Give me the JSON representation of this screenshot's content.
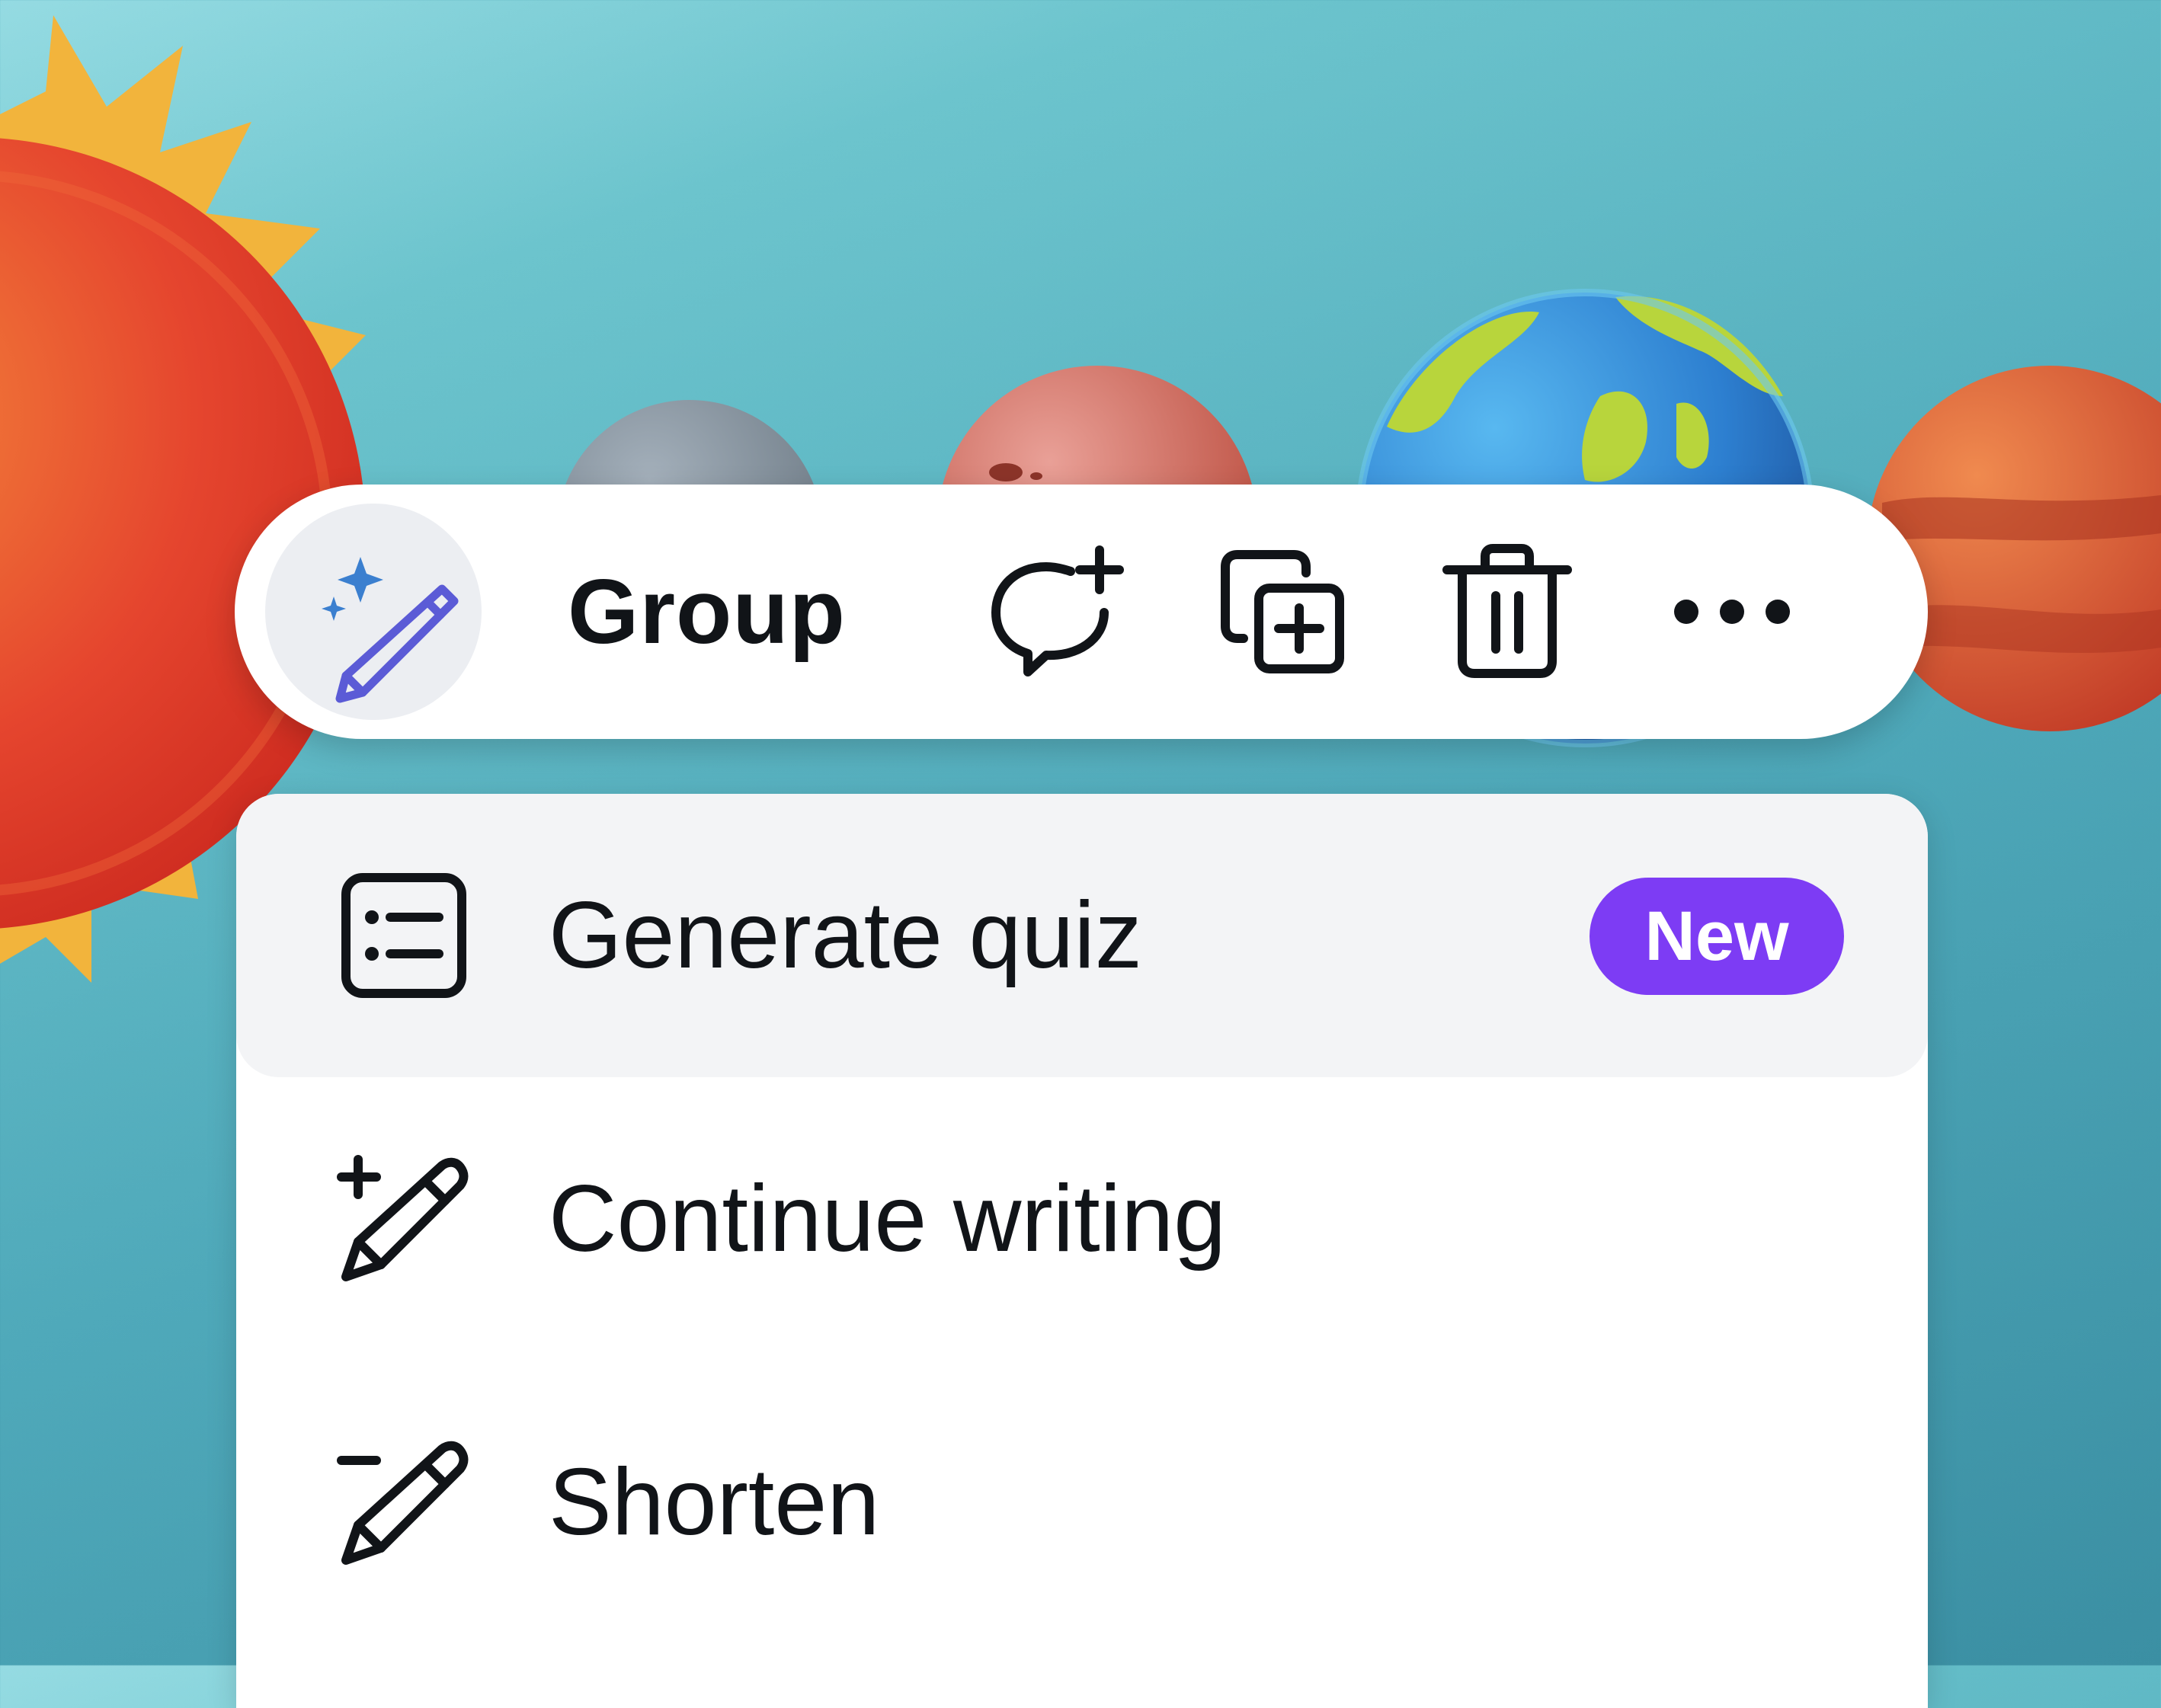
{
  "toolbar": {
    "magic_button_icon": "magic-pencil-icon",
    "group_label": "Group",
    "comment_icon": "add-comment-icon",
    "duplicate_icon": "duplicate-icon",
    "delete_icon": "trash-icon",
    "more_icon": "more-horizontal-icon"
  },
  "menu": {
    "items": [
      {
        "label": "Generate quiz",
        "icon": "quiz-list-icon",
        "badge": "New",
        "active": true
      },
      {
        "label": "Continue writing",
        "icon": "pencil-plus-icon",
        "active": false
      },
      {
        "label": "Shorten",
        "icon": "pencil-minus-icon",
        "active": false
      }
    ]
  },
  "colors": {
    "background": "#4fa9ba",
    "badge": "#7d3cf4",
    "magic_icon": "#5b5bd6",
    "sparkle": "#3b7fcf",
    "text": "#111418"
  }
}
